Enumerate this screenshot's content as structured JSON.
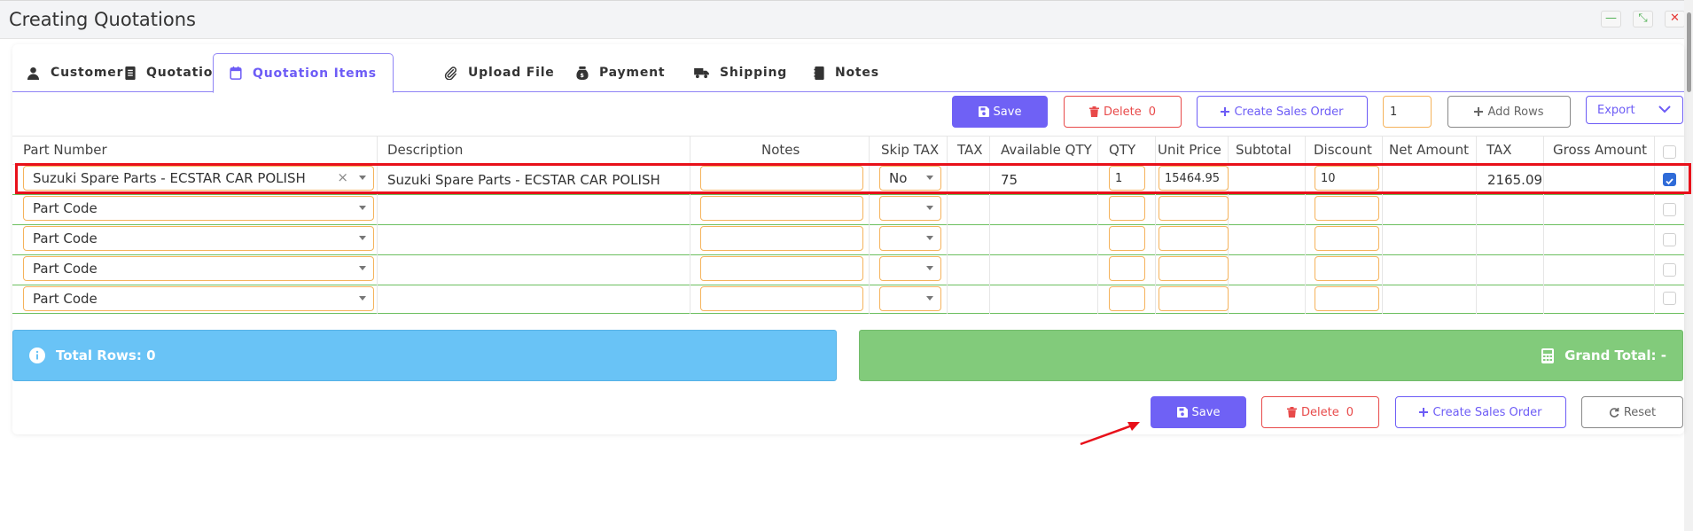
{
  "window": {
    "title": "Creating Quotations",
    "controls": {
      "minimize": "—",
      "restore": "⤡",
      "close": "✕"
    }
  },
  "colors": {
    "accent": "#6f61f5",
    "danger": "#e84a4a",
    "warning_border": "#f5b35c",
    "info_bg": "#69c3f6",
    "success_bg": "#82cb7b",
    "highlight": "#e8101a"
  },
  "tabs": [
    {
      "label": "Customer",
      "icon": "user-icon"
    },
    {
      "label": "Quotation",
      "icon": "document-icon"
    },
    {
      "label": "Quotation Items",
      "icon": "calendar-icon",
      "active": true
    },
    {
      "label": "Upload File",
      "icon": "paperclip-icon"
    },
    {
      "label": "Payment",
      "icon": "money-bag-icon"
    },
    {
      "label": "Shipping",
      "icon": "truck-icon"
    },
    {
      "label": "Notes",
      "icon": "notebook-icon"
    }
  ],
  "toolbar": {
    "save": "Save",
    "delete": "Delete",
    "delete_count": "0",
    "create_sales_order": "Create Sales Order",
    "row_count_value": "1",
    "add_rows": "Add Rows",
    "export": "Export"
  },
  "columns": [
    "Part Number",
    "Description",
    "Notes",
    "Skip TAX",
    "TAX",
    "Available QTY",
    "QTY",
    "Unit Price",
    "Subtotal",
    "Discount",
    "Net Amount",
    "TAX",
    "Gross Amount"
  ],
  "rows": [
    {
      "part_number": "Suzuki Spare Parts - ECSTAR CAR POLISH",
      "description": "Suzuki Spare Parts - ECSTAR CAR POLISH",
      "notes": "",
      "skip_tax": "No",
      "tax": "",
      "available_qty": "75",
      "qty": "1",
      "unit_price": "15464.95",
      "subtotal": "",
      "discount": "10",
      "net_amount": "",
      "tax2": "2165.09",
      "gross_amount": "",
      "checked": true
    },
    {
      "part_number": "Part Code",
      "checked": false
    },
    {
      "part_number": "Part Code",
      "checked": false
    },
    {
      "part_number": "Part Code",
      "checked": false
    },
    {
      "part_number": "Part Code",
      "checked": false
    }
  ],
  "summary": {
    "total_rows_label": "Total Rows:",
    "total_rows_value": "0",
    "grand_total_label": "Grand Total:",
    "grand_total_value": "-"
  },
  "footer": {
    "save": "Save",
    "delete": "Delete",
    "delete_count": "0",
    "create_sales_order": "Create Sales Order",
    "reset": "Reset"
  }
}
